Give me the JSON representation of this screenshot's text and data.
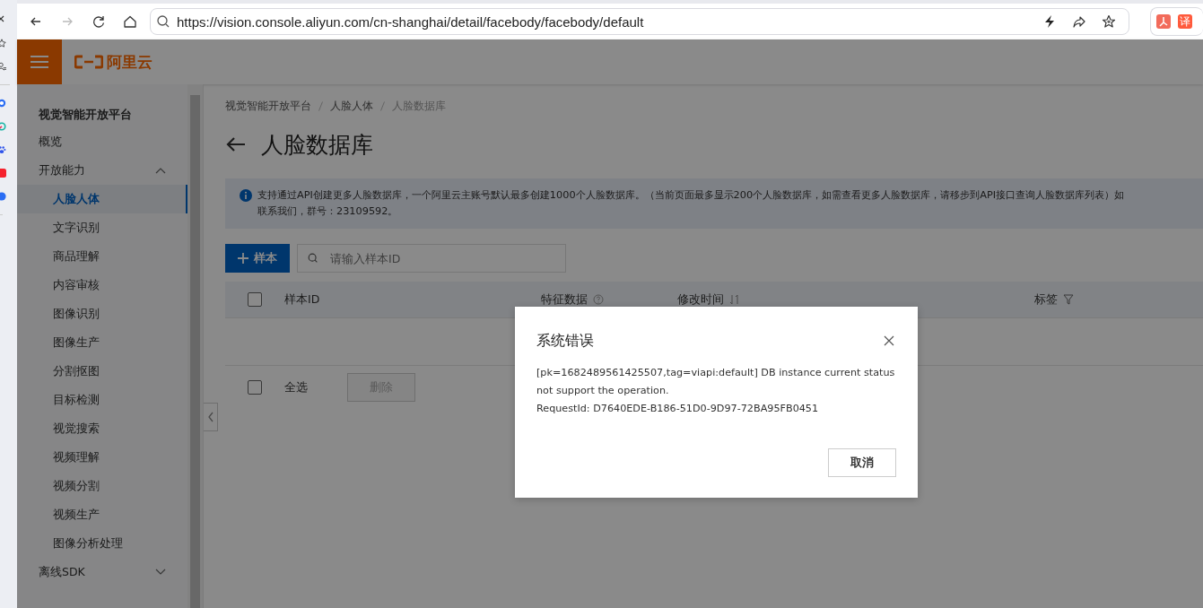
{
  "browser": {
    "url": "https://vision.console.aliyun.com/cn-shanghai/detail/facebody/facebody/default",
    "extension_label": "译"
  },
  "topbar": {
    "logo_text": "阿里云"
  },
  "sidebar": {
    "title": "视觉智能开放平台",
    "items": [
      {
        "label": "概览",
        "selected": false
      },
      {
        "label": "开放能力",
        "selected": false,
        "expanded": true,
        "children": [
          {
            "label": "人脸人体",
            "selected": true
          },
          {
            "label": "文字识别",
            "selected": false
          },
          {
            "label": "商品理解",
            "selected": false
          },
          {
            "label": "内容审核",
            "selected": false
          },
          {
            "label": "图像识别",
            "selected": false
          },
          {
            "label": "图像生产",
            "selected": false
          },
          {
            "label": "分割抠图",
            "selected": false
          },
          {
            "label": "目标检测",
            "selected": false
          },
          {
            "label": "视觉搜索",
            "selected": false
          },
          {
            "label": "视频理解",
            "selected": false
          },
          {
            "label": "视频分割",
            "selected": false
          },
          {
            "label": "视频生产",
            "selected": false
          },
          {
            "label": "图像分析处理",
            "selected": false
          }
        ]
      },
      {
        "label": "离线SDK",
        "selected": false,
        "expanded": false
      }
    ]
  },
  "breadcrumb": [
    "视觉智能开放平台",
    "人脸人体",
    "人脸数据库"
  ],
  "page_title": "人脸数据库",
  "notice": {
    "lines": [
      "支持通过API创建更多人脸数据库，一个阿里云主账号默认最多创建1000个人脸数据库。（当前页面最多显示200个人脸数据库，如需查看更多人脸数据库，请移步到API接口查询人脸数据库列表）如",
      "联系我们，群号：23109592。"
    ]
  },
  "toolbar": {
    "add_button": "样本",
    "search_placeholder": "请输入样本ID"
  },
  "table": {
    "columns": [
      {
        "label": "样本ID",
        "kind": "plain"
      },
      {
        "label": "特征数据",
        "kind": "help"
      },
      {
        "label": "修改时间",
        "kind": "sort"
      },
      {
        "label": "标签",
        "kind": "filter"
      }
    ],
    "select_all_checked": false
  },
  "footer": {
    "select_all_label": "全选",
    "select_all_checked": false,
    "delete_button": "删除",
    "delete_disabled": true
  },
  "dialog": {
    "title": "系统错误",
    "message": "[pk=1682489561425507,tag=viapi:default] DB instance current status not support the operation.",
    "request_id": "RequestId: D7640EDE-B186-51D0-9D97-72BA95FB0451",
    "cancel_button": "取消"
  }
}
